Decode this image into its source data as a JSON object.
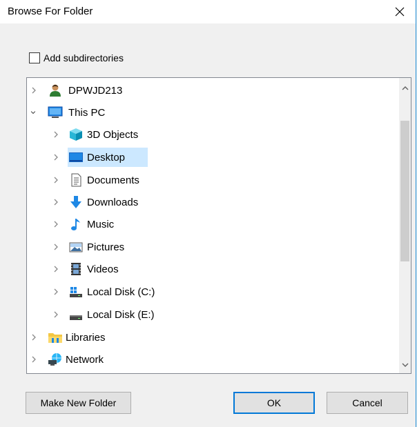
{
  "window": {
    "title": "Browse For Folder"
  },
  "options": {
    "add_subdirectories_label": "Add subdirectories",
    "add_subdirectories_checked": false
  },
  "tree": {
    "items": [
      {
        "label": "DPWJD213",
        "icon": "user-icon",
        "expanded": false,
        "selected": false
      },
      {
        "label": "This PC",
        "icon": "computer-icon",
        "expanded": true,
        "selected": false
      },
      {
        "label": "3D Objects",
        "icon": "cube-icon",
        "expanded": false,
        "selected": false
      },
      {
        "label": "Desktop",
        "icon": "desktop-icon",
        "expanded": false,
        "selected": true
      },
      {
        "label": "Documents",
        "icon": "document-icon",
        "expanded": false,
        "selected": false
      },
      {
        "label": "Downloads",
        "icon": "download-icon",
        "expanded": false,
        "selected": false
      },
      {
        "label": "Music",
        "icon": "music-icon",
        "expanded": false,
        "selected": false
      },
      {
        "label": "Pictures",
        "icon": "pictures-icon",
        "expanded": false,
        "selected": false
      },
      {
        "label": "Videos",
        "icon": "videos-icon",
        "expanded": false,
        "selected": false
      },
      {
        "label": "Local Disk (C:)",
        "icon": "windows-drive-icon",
        "expanded": false,
        "selected": false
      },
      {
        "label": "Local Disk (E:)",
        "icon": "drive-icon",
        "expanded": false,
        "selected": false
      },
      {
        "label": "Libraries",
        "icon": "libraries-icon",
        "expanded": false,
        "selected": false
      },
      {
        "label": "Network",
        "icon": "network-icon",
        "expanded": false,
        "selected": false
      }
    ]
  },
  "buttons": {
    "make_new_folder": "Make New Folder",
    "ok": "OK",
    "cancel": "Cancel"
  },
  "colors": {
    "selection": "#cce8ff",
    "accent": "#0078d7"
  }
}
